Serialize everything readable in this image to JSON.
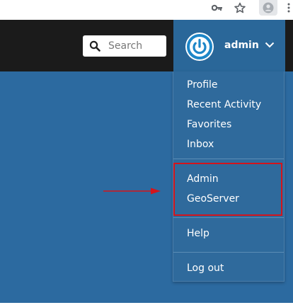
{
  "search": {
    "placeholder": "Search"
  },
  "user": {
    "name": "admin"
  },
  "dropdown": {
    "group1": [
      "Profile",
      "Recent Activity",
      "Favorites",
      "Inbox"
    ],
    "group2": [
      "Admin",
      "GeoServer"
    ],
    "group3": [
      "Help"
    ],
    "group4": [
      "Log out"
    ]
  },
  "icons": {
    "browser_key": "key-icon",
    "browser_star": "star-icon",
    "browser_profile": "person-icon",
    "search": "search-icon",
    "avatar": "power-icon",
    "toggle": "chevron-down-icon",
    "annotation": "arrow-right-icon"
  },
  "colors": {
    "header_bg": "#1b1b1b",
    "user_toggle_bg": "#2a6799",
    "page_bg": "#2c6aa0",
    "dropdown_bg": "#2f6a9c",
    "avatar_ring": "#1d86c8",
    "highlight": "#d4141b"
  }
}
